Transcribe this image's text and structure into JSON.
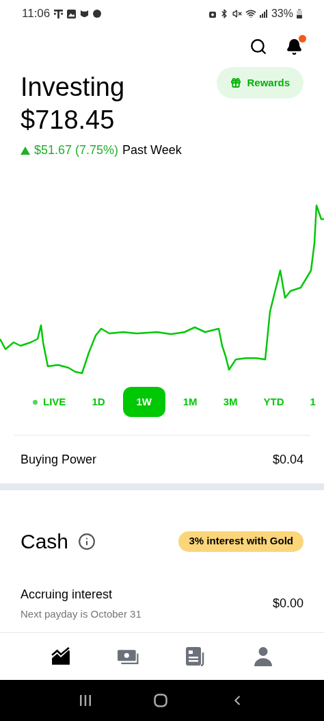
{
  "status_bar": {
    "time": "11:06",
    "battery": "33%"
  },
  "header": {
    "notifications_unread": true,
    "rewards_button": "Rewards"
  },
  "portfolio": {
    "title": "Investing",
    "value": "$718.45",
    "change": "$51.67 (7.75%)",
    "period": "Past Week"
  },
  "range_tabs": [
    {
      "label": "LIVE",
      "kind": "live",
      "selected": false
    },
    {
      "label": "1D",
      "kind": "range",
      "selected": false
    },
    {
      "label": "1W",
      "kind": "range",
      "selected": true
    },
    {
      "label": "1M",
      "kind": "range",
      "selected": false
    },
    {
      "label": "3M",
      "kind": "range",
      "selected": false
    },
    {
      "label": "YTD",
      "kind": "range",
      "selected": false
    },
    {
      "label": "1",
      "kind": "range",
      "selected": false
    }
  ],
  "buying_power": {
    "label": "Buying Power",
    "value": "$0.04"
  },
  "cash": {
    "title": "Cash",
    "badge": "3% interest with Gold",
    "row": {
      "label": "Accruing interest",
      "sublabel": "Next payday is October 31",
      "value": "$0.00"
    }
  },
  "bottom_nav": [
    {
      "kind": "investing",
      "selected": true
    },
    {
      "kind": "cash",
      "selected": false
    },
    {
      "kind": "news",
      "selected": false
    },
    {
      "kind": "account",
      "selected": false
    }
  ]
}
